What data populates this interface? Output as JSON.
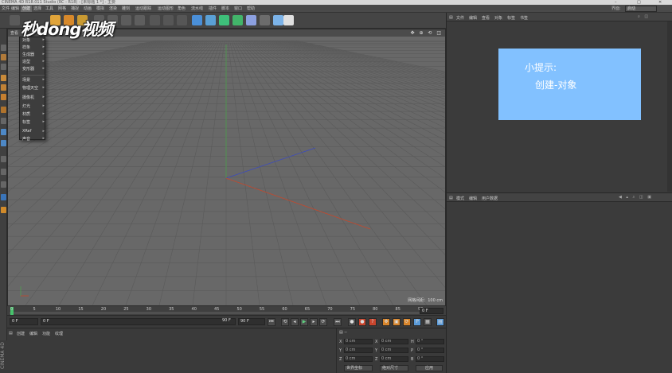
{
  "titlebar": {
    "text": "CINEMA 4D R18.011 Studio (RC - R18) - [未标题 1 *] - 主要",
    "win_controls": [
      "–",
      "□",
      "✕"
    ]
  },
  "menubar": {
    "items": [
      "文件",
      "编辑",
      "创建",
      "选择",
      "工具",
      "网格",
      "捕捉",
      "动画",
      "模拟",
      "渲染",
      "雕刻",
      "运动跟踪",
      "运动图形",
      "角色",
      "流水线",
      "插件",
      "脚本",
      "窗口",
      "帮助"
    ],
    "active_index": 2,
    "layout_label": "界面:",
    "layout_value": "启动"
  },
  "watermark": {
    "text": "秒dong视频"
  },
  "dropdown": {
    "items": [
      "对象",
      "样条",
      "生成器",
      "造型",
      "变形器",
      "场景",
      "物理天空",
      "摄像机",
      "灯光",
      "材质",
      "标签",
      "XRef",
      "声音"
    ]
  },
  "viewport": {
    "menu": [
      "查看",
      "摄像机",
      "显示",
      "选项",
      "过滤",
      "面板"
    ],
    "nav_icons": "✥ ⊕ ⟲ ◫",
    "grid_scale": "网格间距：100 cm"
  },
  "timeline": {
    "ticks": [
      "0",
      "5",
      "10",
      "15",
      "20",
      "25",
      "30",
      "35",
      "40",
      "45",
      "50",
      "55",
      "60",
      "65",
      "70",
      "75",
      "80",
      "85",
      "90"
    ],
    "current_frame": "0 F"
  },
  "transport": {
    "start": "0 F",
    "min": "0 F",
    "max": "90 F",
    "end": "90 F"
  },
  "materials": {
    "menu": [
      "创建",
      "编辑",
      "功能",
      "纹理"
    ]
  },
  "app_vertical_label": "CINEMA 4D",
  "coords": {
    "rows": [
      {
        "axis": "X",
        "pos": "0 cm",
        "size": "0 cm",
        "rot_label": "H",
        "rot": "0 °"
      },
      {
        "axis": "Y",
        "pos": "0 cm",
        "size": "0 cm",
        "rot_label": "P",
        "rot": "0 °"
      },
      {
        "axis": "Z",
        "pos": "0 cm",
        "size": "0 cm",
        "rot_label": "B",
        "rot": "0 °"
      }
    ],
    "mode_select": "世界坐标",
    "scale_select": "绝对尺寸",
    "apply": "应用"
  },
  "objmgr": {
    "menu": [
      "文件",
      "编辑",
      "查看",
      "对象",
      "标签",
      "书签"
    ]
  },
  "attrmgr": {
    "menu": [
      "模式",
      "编辑",
      "用户数据"
    ]
  },
  "tip": {
    "title": "小提示:",
    "body": "创建-对象"
  },
  "colors": {
    "accent": "#82c1ff",
    "x_axis": "#c5482c",
    "y_axis": "#4ea04e",
    "z_axis": "#3a4ac0",
    "playhead": "#46c26b"
  }
}
